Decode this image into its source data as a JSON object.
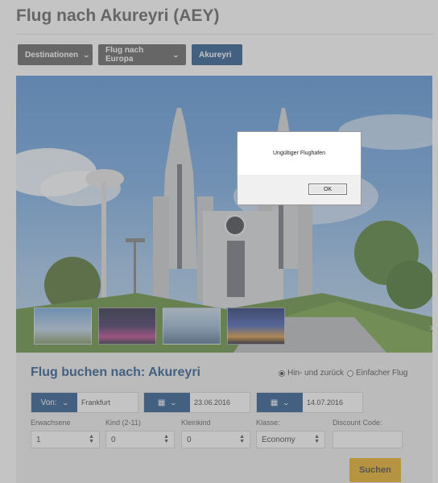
{
  "page": {
    "title": "Flug nach Akureyri (AEY)"
  },
  "breadcrumb": {
    "items": [
      {
        "label": "Destinationen"
      },
      {
        "label": "Flug nach Europa"
      },
      {
        "label": "Akureyri"
      }
    ]
  },
  "booking": {
    "title": "Flug buchen nach: Akureyri",
    "trip_type": {
      "roundtrip": "Hin- und zurück",
      "oneway": "Einfacher Flug",
      "selected": "roundtrip"
    },
    "from": {
      "label": "Von:",
      "value": "Frankfurt"
    },
    "depart_date": "23.06.2016",
    "return_date": "14.07.2016",
    "adults": {
      "label": "Erwachsene",
      "value": "1"
    },
    "children": {
      "label": "Kind (2-11)",
      "value": "0"
    },
    "infants": {
      "label": "Kleinkind",
      "value": "0"
    },
    "class": {
      "label": "Klasse:",
      "value": "Economy"
    },
    "discount": {
      "label": "Discount Code:",
      "value": ""
    },
    "search_label": "Suchen"
  },
  "dialog": {
    "message": "Ungültiger Flughafen",
    "ok_label": "OK"
  },
  "colors": {
    "primary": "#1d4f8a",
    "accent": "#e9ab1a",
    "crumb_grey": "#5b5b5b"
  },
  "icons": {
    "calendar": "calendar-icon",
    "chevron": "chevron-down-icon",
    "next": "chevron-right-icon"
  }
}
